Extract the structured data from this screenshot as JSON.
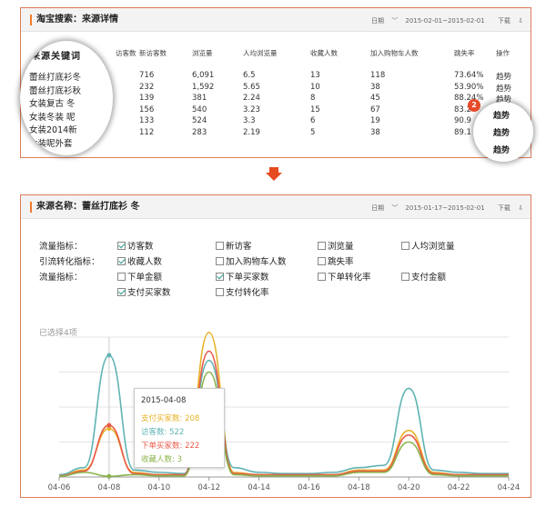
{
  "top_panel": {
    "title": "淘宝搜索：来源详情",
    "date_label": "日期",
    "date_range": "2015-02-01~2015-02-01",
    "download": "下载",
    "columns": [
      "访客数",
      "新访客数",
      "浏览量",
      "人均浏览量",
      "收藏人数",
      "加入购物车人数",
      "跳失率",
      "操作"
    ],
    "rows": [
      [
        "716",
        "6,091",
        "6.5",
        "13",
        "118",
        "73.64%",
        "趋势"
      ],
      [
        "232",
        "1,592",
        "5.65",
        "10",
        "38",
        "53.90%",
        "趋势"
      ],
      [
        "139",
        "381",
        "2.24",
        "8",
        "45",
        "88.24%",
        "趋势"
      ],
      [
        "156",
        "540",
        "3.23",
        "15",
        "67",
        "83.2",
        ""
      ],
      [
        "133",
        "524",
        "3.3",
        "6",
        "19",
        "90.9",
        ""
      ],
      [
        "112",
        "283",
        "2.19",
        "5",
        "38",
        "89.1",
        ""
      ]
    ]
  },
  "magnifier_keywords": {
    "title": "来源关键词",
    "items": [
      "蕾丝打底衫冬",
      "蕾丝打底衫秋",
      "女装复古 冬",
      "女装冬装 呢",
      "女装2014新",
      "女装呢外套"
    ]
  },
  "magnifier_actions": {
    "badge": "2",
    "items": [
      "趋势",
      "趋势",
      "趋势"
    ]
  },
  "bottom_panel": {
    "title": "来源名称：蕾丝打底衫 冬",
    "date_label": "日期",
    "date_range": "2015-01-17~2015-02-01",
    "download": "下载",
    "filter_groups": [
      {
        "label": "流量指标：",
        "options": [
          {
            "text": "访客数",
            "checked": true
          },
          {
            "text": "新访客",
            "checked": false
          },
          {
            "text": "浏览量",
            "checked": false
          },
          {
            "text": "人均浏览量",
            "checked": false
          }
        ]
      },
      {
        "label": "引流转化指标：",
        "options": [
          {
            "text": "收藏人数",
            "checked": true
          },
          {
            "text": "加入购物车人数",
            "checked": false
          },
          {
            "text": "跳失率",
            "checked": false
          }
        ]
      },
      {
        "label": "流量指标：",
        "options": [
          {
            "text": "下单金额",
            "checked": false
          },
          {
            "text": "下单买家数",
            "checked": true
          },
          {
            "text": "下单转化率",
            "checked": false
          },
          {
            "text": "支付金额",
            "checked": false
          }
        ]
      },
      {
        "label": "",
        "options": [
          {
            "text": "支付买家数",
            "checked": true
          },
          {
            "text": "支付转化率",
            "checked": false
          }
        ]
      }
    ],
    "selected_count": "已选择4项"
  },
  "chart_data": {
    "type": "line",
    "x": [
      "04-06",
      "04-07",
      "04-08",
      "04-09",
      "04-10",
      "04-11",
      "04-12",
      "04-13",
      "04-14",
      "04-15",
      "04-16",
      "04-17",
      "04-18",
      "04-19",
      "04-20",
      "04-21",
      "04-22",
      "04-23",
      "04-24"
    ],
    "tick_labels": [
      "04-06",
      "04-08",
      "04-10",
      "04-12",
      "04-14",
      "04-16",
      "04-18",
      "04-20",
      "04-22",
      "04-24"
    ],
    "ylim": [
      0,
      600
    ],
    "grid": true,
    "series": [
      {
        "name": "支付买家数",
        "color": "#e8b22a",
        "values": [
          5,
          30,
          208,
          20,
          10,
          10,
          620,
          20,
          10,
          10,
          10,
          10,
          30,
          30,
          200,
          20,
          10,
          10,
          10
        ]
      },
      {
        "name": "访客数",
        "color": "#5fb3b3",
        "values": [
          10,
          40,
          522,
          30,
          20,
          15,
          500,
          40,
          20,
          15,
          15,
          20,
          40,
          50,
          380,
          30,
          20,
          15,
          15
        ]
      },
      {
        "name": "下单买家数",
        "color": "#e85a4a",
        "values": [
          5,
          25,
          222,
          15,
          10,
          10,
          540,
          15,
          10,
          10,
          10,
          10,
          25,
          25,
          180,
          15,
          10,
          10,
          10
        ]
      },
      {
        "name": "收藏人数",
        "color": "#8ab34a",
        "values": [
          3,
          20,
          3,
          10,
          5,
          5,
          450,
          10,
          5,
          5,
          5,
          5,
          20,
          20,
          150,
          10,
          5,
          5,
          5
        ]
      }
    ],
    "tooltip": {
      "date": "2015-04-08",
      "lines": [
        "支付买家数: 208",
        "访客数: 522",
        "下单买家数: 222",
        "收藏人数: 3"
      ]
    }
  }
}
